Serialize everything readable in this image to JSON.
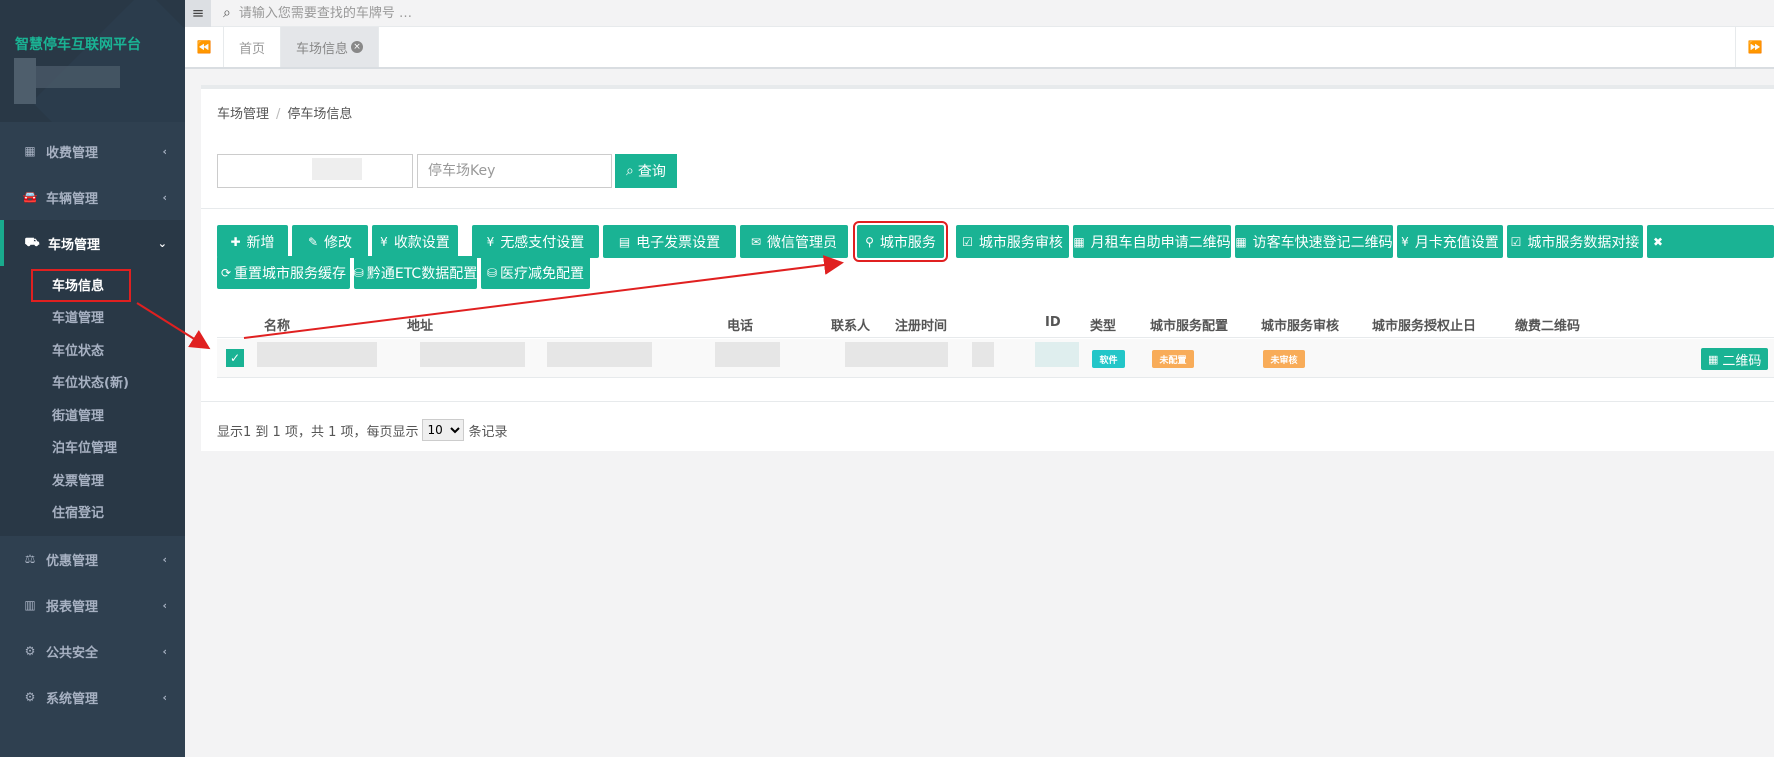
{
  "sidebar": {
    "brand": "智慧停车互联网平台",
    "menu": [
      {
        "label": "收费管理",
        "icon": "grid-icon"
      },
      {
        "label": "车辆管理",
        "icon": "car-icon"
      },
      {
        "label": "车场管理",
        "icon": "road-icon",
        "expanded": true
      },
      {
        "label": "优惠管理",
        "icon": "balance-icon"
      },
      {
        "label": "报表管理",
        "icon": "bar-chart-icon"
      },
      {
        "label": "公共安全",
        "icon": "cogs-icon"
      },
      {
        "label": "系统管理",
        "icon": "cogs-icon"
      }
    ],
    "submenu": [
      "车场信息",
      "车道管理",
      "车位状态",
      "车位状态(新)",
      "街道管理",
      "泊车位管理",
      "发票管理",
      "住宿登记"
    ]
  },
  "topbar": {
    "search_placeholder": "请输入您需要查找的车牌号 …"
  },
  "tabs": {
    "home": "首页",
    "current": "车场信息"
  },
  "breadcrumb": {
    "parent": "车场管理",
    "current": "停车场信息"
  },
  "filters": {
    "key_placeholder": "停车场Key",
    "query_label": "查询"
  },
  "toolbar": {
    "buttons": [
      "新增",
      "修改",
      "收款设置",
      "无感支付设置",
      "电子发票设置",
      "微信管理员",
      "城市服务",
      "城市服务审核",
      "月租车自助申请二维码",
      "访客车快速登记二维码",
      "月卡充值设置",
      "城市服务数据对接",
      "重置城市服务缓存",
      "黔通ETC数据配置",
      "医疗减免配置"
    ]
  },
  "table": {
    "headers": [
      "名称",
      "地址",
      "电话",
      "联系人",
      "注册时间",
      "ID",
      "类型",
      "城市服务配置",
      "城市服务审核",
      "城市服务授权止日",
      "缴费二维码"
    ],
    "row": {
      "type_badge": "软件",
      "config_badge": "未配置",
      "review_badge": "未审核",
      "qr_label": "二维码"
    }
  },
  "pagination": {
    "summary": "显示1 到 1 项，共 1 项，每页显示",
    "page_size": "10",
    "suffix": "条记录"
  },
  "colors": {
    "sidebar": "#2f4050",
    "accent": "#1ab394",
    "highlight": "#e02020"
  }
}
